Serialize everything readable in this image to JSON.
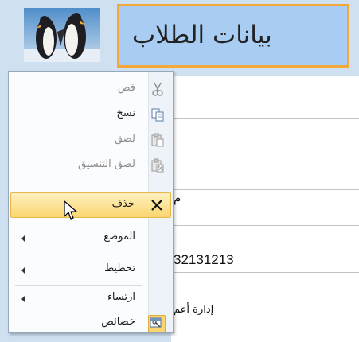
{
  "form": {
    "title": "بيانات الطلاب",
    "field_partial_1": "م",
    "phone_value": "32131213",
    "department_partial": "إدارة أعم"
  },
  "context_menu": {
    "items": [
      {
        "label": "قص",
        "icon": "scissors-icon",
        "enabled": false
      },
      {
        "label": "نسخ",
        "icon": "copy-icon",
        "enabled": true
      },
      {
        "label": "لصق",
        "icon": "paste-icon",
        "enabled": false
      },
      {
        "label": "لصق التنسيق",
        "icon": "paste-formatting-icon",
        "enabled": false
      },
      {
        "label": "حذف",
        "icon": "delete-x-icon",
        "enabled": true,
        "highlighted": true
      },
      {
        "label": "الموضع",
        "submenu": true,
        "enabled": true
      },
      {
        "label": "تخطيط",
        "submenu": true,
        "enabled": true
      },
      {
        "label": "ارتساء",
        "submenu": true,
        "enabled": true
      },
      {
        "label": "خصائص",
        "icon": "properties-icon",
        "enabled": true
      }
    ]
  },
  "colors": {
    "form_background": "#cfe0f1",
    "title_fill": "#a9cdf2",
    "title_border": "#f4a73b",
    "menu_highlight": "#fbd66f"
  }
}
